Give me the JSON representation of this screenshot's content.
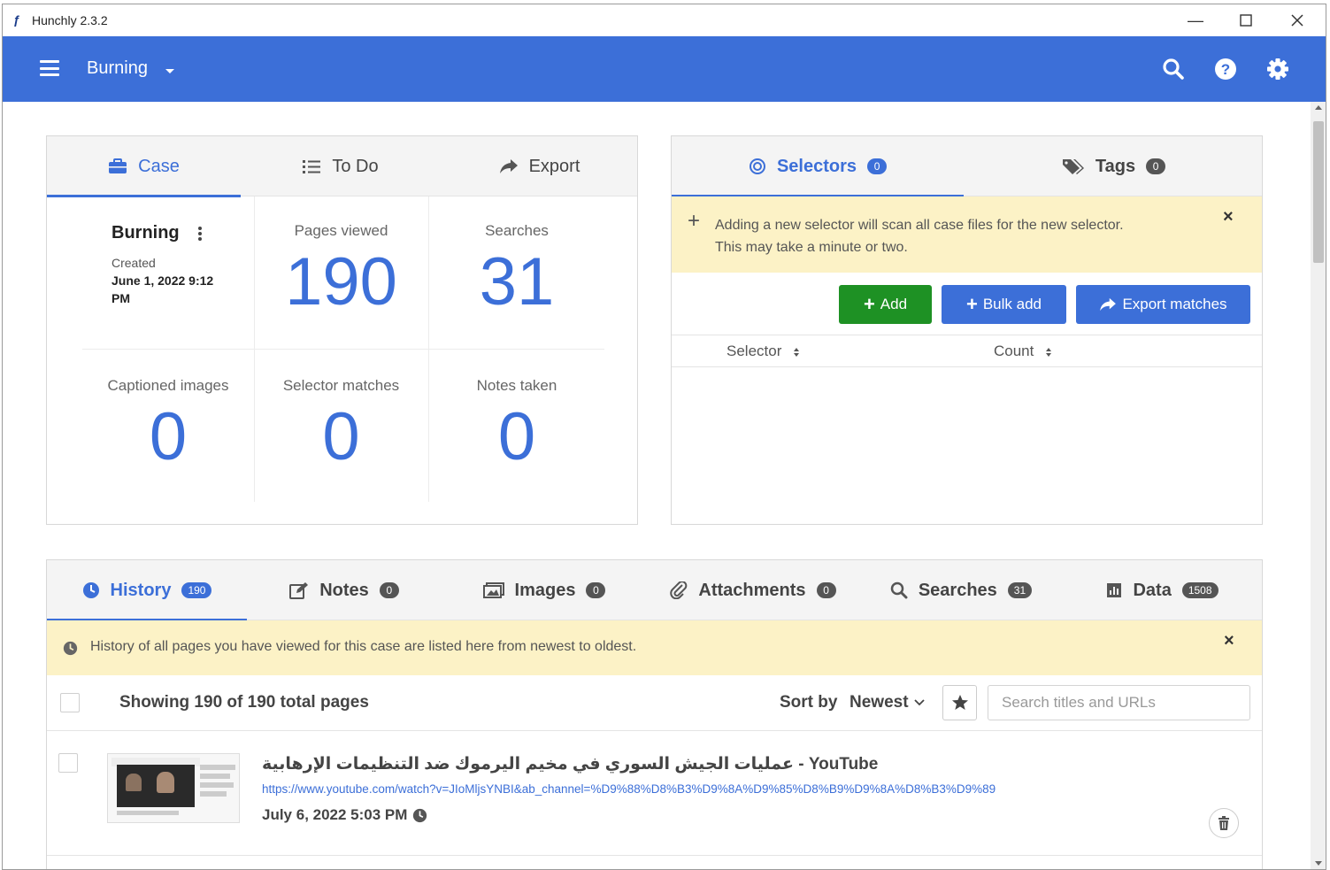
{
  "window": {
    "app_title": "Hunchly 2.3.2"
  },
  "appbar": {
    "case_name": "Burning"
  },
  "case_panel": {
    "tabs": [
      {
        "label": "Case",
        "icon": "briefcase-icon"
      },
      {
        "label": "To Do",
        "icon": "list-icon"
      },
      {
        "label": "Export",
        "icon": "share-icon"
      }
    ],
    "case_title": "Burning",
    "created_label": "Created",
    "created_date": "June 1, 2022 9:12",
    "created_time_suffix": "PM",
    "stats": {
      "pages_viewed": {
        "label": "Pages viewed",
        "value": "190"
      },
      "searches": {
        "label": "Searches",
        "value": "31"
      },
      "captioned_images": {
        "label": "Captioned images",
        "value": "0"
      },
      "selector_matches": {
        "label": "Selector matches",
        "value": "0"
      },
      "notes_taken": {
        "label": "Notes taken",
        "value": "0"
      }
    }
  },
  "selectors_panel": {
    "tabs": [
      {
        "label": "Selectors",
        "count": "0",
        "icon": "target-icon"
      },
      {
        "label": "Tags",
        "count": "0",
        "icon": "tags-icon"
      }
    ],
    "notice_line1": "Adding a new selector will scan all case files for the new selector.",
    "notice_line2": "This may take a minute or two.",
    "buttons": {
      "add": "Add",
      "bulk_add": "Bulk add",
      "export_matches": "Export matches"
    },
    "columns": {
      "selector": "Selector",
      "count": "Count"
    }
  },
  "history_panel": {
    "tabs": [
      {
        "label": "History",
        "count": "190",
        "icon": "clock-icon"
      },
      {
        "label": "Notes",
        "count": "0",
        "icon": "edit-icon"
      },
      {
        "label": "Images",
        "count": "0",
        "icon": "images-icon"
      },
      {
        "label": "Attachments",
        "count": "0",
        "icon": "paperclip-icon"
      },
      {
        "label": "Searches",
        "count": "31",
        "icon": "search-icon"
      },
      {
        "label": "Data",
        "count": "1508",
        "icon": "chart-icon"
      }
    ],
    "notice": "History of all pages you have viewed for this case are listed here from newest to oldest.",
    "showing": "Showing 190 of 190 total pages",
    "sort_label": "Sort by",
    "sort_value": "Newest",
    "search_placeholder": "Search titles and URLs",
    "rows": [
      {
        "title_rtl": "عمليات الجيش السوري في مخيم اليرموك ضد التنظيمات الإرهابية",
        "title_suffix": "- YouTube",
        "url": "https://www.youtube.com/watch?v=JIoMljsYNBI&ab_channel=%D9%88%D8%B3%D9%8A%D9%85%D8%B9%D9%8A%D8%B3%D9%89",
        "date": "July 6, 2022 5:03 PM"
      }
    ]
  },
  "colors": {
    "primary": "#3c6fd8",
    "success": "#1e9124",
    "notice_bg": "#fcf2c6"
  }
}
